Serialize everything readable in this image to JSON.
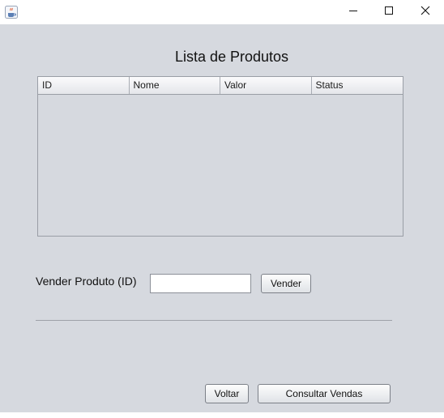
{
  "window": {
    "icons": {
      "app": "java-coffee-icon",
      "minimize": "minimize-icon",
      "maximize": "maximize-icon",
      "close": "close-icon"
    }
  },
  "main": {
    "title": "Lista de Produtos",
    "table": {
      "columns": [
        "ID",
        "Nome",
        "Valor",
        "Status"
      ],
      "rows": []
    },
    "sell": {
      "label": "Vender Produto (ID)",
      "input_value": "",
      "button_label": "Vender"
    },
    "footer": {
      "back_label": "Voltar",
      "sales_label": "Consultar Vendas"
    }
  }
}
